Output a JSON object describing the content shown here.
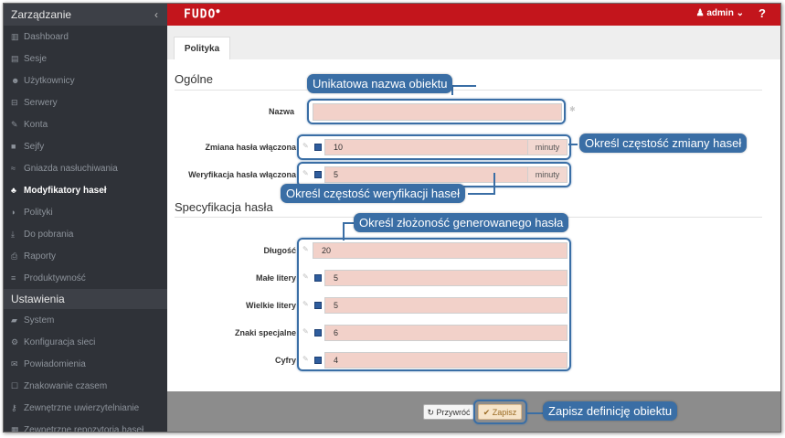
{
  "sidebar": {
    "header": "Zarządzanie",
    "collapse_icon": "chevron-left-icon",
    "items": [
      {
        "label": "Dashboard",
        "icon": "chart-icon"
      },
      {
        "label": "Sesje",
        "icon": "film-icon"
      },
      {
        "label": "Użytkownicy",
        "icon": "users-icon"
      },
      {
        "label": "Serwery",
        "icon": "server-icon"
      },
      {
        "label": "Konta",
        "icon": "pencil-icon"
      },
      {
        "label": "Sejfy",
        "icon": "safe-icon"
      },
      {
        "label": "Gniazda nasłuchiwania",
        "icon": "wifi-icon"
      },
      {
        "label": "Modyfikatory haseł",
        "icon": "sitemap-icon"
      },
      {
        "label": "Polityki",
        "icon": "shield-icon"
      },
      {
        "label": "Do pobrania",
        "icon": "download-icon"
      },
      {
        "label": "Raporty",
        "icon": "print-icon"
      },
      {
        "label": "Produktywność",
        "icon": "bars-icon"
      }
    ],
    "active_index": 7,
    "section2": "Ustawienia",
    "items2": [
      {
        "label": "System",
        "icon": "folder-icon"
      },
      {
        "label": "Konfiguracja sieci",
        "icon": "gears-icon"
      },
      {
        "label": "Powiadomienia",
        "icon": "envelope-icon"
      },
      {
        "label": "Znakowanie czasem",
        "icon": "edit-icon"
      },
      {
        "label": "Zewnętrzne uwierzytelnianie",
        "icon": "key-icon"
      },
      {
        "label": "Zewnętrzne repozytoria haseł",
        "icon": "grid-icon"
      }
    ]
  },
  "topbar": {
    "logo": "FUDO",
    "user": "admin",
    "help": "?",
    "color": "#c3151c"
  },
  "tab": "Polityka",
  "sections": {
    "general": "Ogólne",
    "spec": "Specyfikacja hasła"
  },
  "fields": {
    "name": {
      "label": "Nazwa",
      "value": ""
    },
    "change": {
      "label": "Zmiana hasła włączona",
      "value": "10",
      "unit": "minuty"
    },
    "verify": {
      "label": "Weryfikacja hasła włączona",
      "value": "5",
      "unit": "minuty"
    },
    "length": {
      "label": "Długość",
      "value": "20"
    },
    "lower": {
      "label": "Małe litery",
      "value": "5"
    },
    "upper": {
      "label": "Wielkie litery",
      "value": "5"
    },
    "special": {
      "label": "Znaki specjalne",
      "value": "6"
    },
    "digits": {
      "label": "Cyfry",
      "value": "4"
    }
  },
  "callouts": {
    "name": "Unikatowa nazwa obiektu",
    "change": "Określ częstość zmiany haseł",
    "verify": "Określ częstość weryfikacji haseł",
    "complexity": "Określ złożoność generowanego hasła",
    "save": "Zapisz definicję obiektu"
  },
  "buttons": {
    "reset": "Przywróć",
    "save": "Zapisz"
  }
}
